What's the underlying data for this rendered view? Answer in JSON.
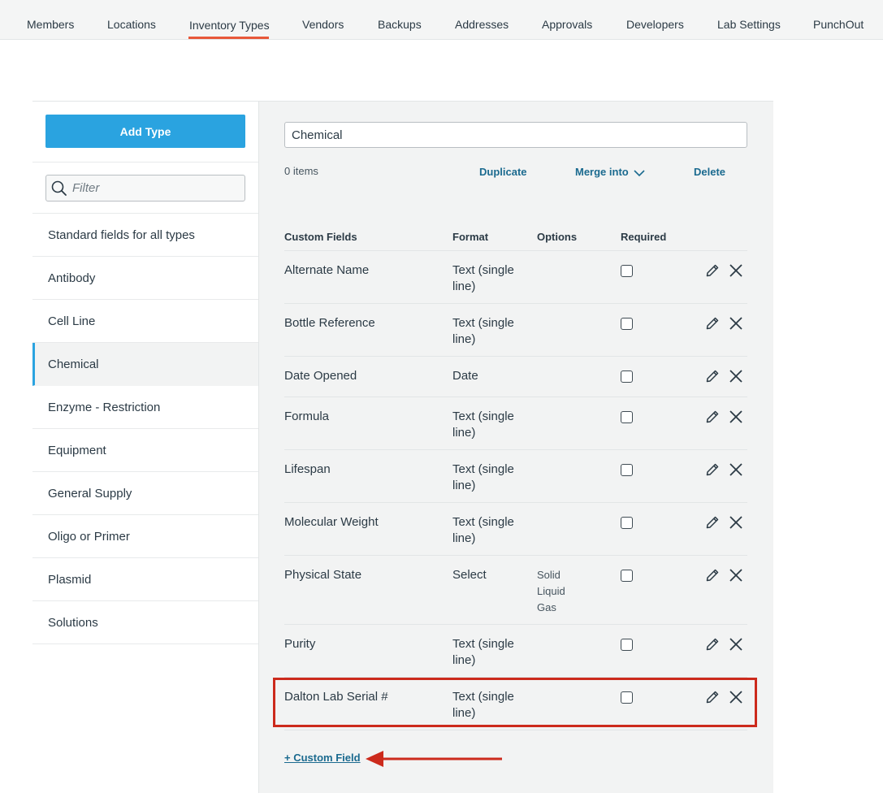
{
  "nav": {
    "tabs": [
      {
        "label": "Members"
      },
      {
        "label": "Locations"
      },
      {
        "label": "Inventory Types",
        "active": true
      },
      {
        "label": "Vendors"
      },
      {
        "label": "Backups"
      },
      {
        "label": "Addresses"
      },
      {
        "label": "Approvals"
      },
      {
        "label": "Developers"
      },
      {
        "label": "Lab Settings"
      },
      {
        "label": "PunchOut"
      }
    ],
    "accent_color": "#e8583a"
  },
  "sidebar": {
    "add_type_label": "Add Type",
    "filter_placeholder": "Filter",
    "types": [
      {
        "label": "Standard fields for all types"
      },
      {
        "label": "Antibody"
      },
      {
        "label": "Cell Line"
      },
      {
        "label": "Chemical",
        "selected": true
      },
      {
        "label": "Enzyme - Restriction"
      },
      {
        "label": "Equipment"
      },
      {
        "label": "General Supply"
      },
      {
        "label": "Oligo or Primer"
      },
      {
        "label": "Plasmid"
      },
      {
        "label": "Solutions"
      }
    ]
  },
  "detail": {
    "type_name": "Chemical",
    "item_count": "0 items",
    "actions": {
      "duplicate": "Duplicate",
      "merge_into": "Merge into",
      "delete": "Delete"
    },
    "columns": {
      "custom_fields": "Custom Fields",
      "format": "Format",
      "options": "Options",
      "required": "Required"
    },
    "fields": [
      {
        "name": "Alternate Name",
        "format": "Text (single line)",
        "options": [],
        "required": false
      },
      {
        "name": "Bottle Reference",
        "format": "Text (single line)",
        "options": [],
        "required": false
      },
      {
        "name": "Date Opened",
        "format": "Date",
        "options": [],
        "required": false
      },
      {
        "name": "Formula",
        "format": "Text (single line)",
        "options": [],
        "required": false
      },
      {
        "name": "Lifespan",
        "format": "Text (single line)",
        "options": [],
        "required": false
      },
      {
        "name": "Molecular Weight",
        "format": "Text (single line)",
        "options": [],
        "required": false
      },
      {
        "name": "Physical State",
        "format": "Select",
        "options": [
          "Solid",
          "Liquid",
          "Gas"
        ],
        "required": false
      },
      {
        "name": "Purity",
        "format": "Text (single line)",
        "options": [],
        "required": false
      },
      {
        "name": "Dalton Lab Serial #",
        "format": "Text (single line)",
        "options": [],
        "required": false,
        "highlighted": true
      }
    ],
    "add_custom_field_label": "+ Custom Field"
  },
  "colors": {
    "primary_button": "#2aa3e0",
    "link": "#1b6a8f",
    "annotation": "#cc2a1c"
  }
}
